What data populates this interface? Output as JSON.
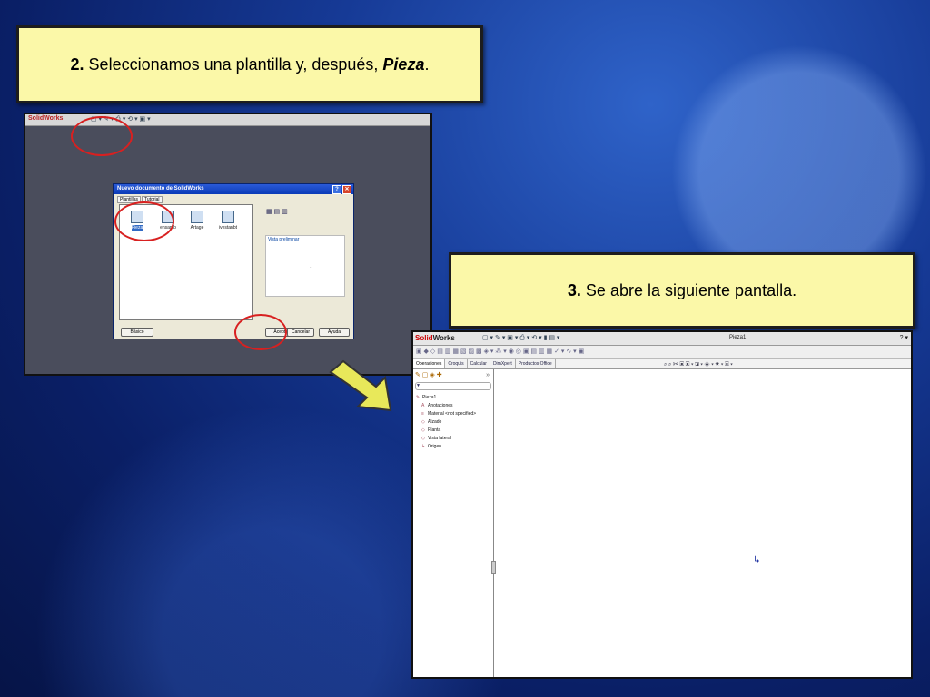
{
  "captions": {
    "step2": {
      "num": "2.",
      "text": " Seleccionamos una plantilla y, después, ",
      "emph": "Pieza",
      "end": "."
    },
    "step3": {
      "num": "3.",
      "text": " Se abre la siguiente pantalla."
    }
  },
  "shot1": {
    "app_logo": "SolidWorks",
    "dialog": {
      "title": "Nuevo documento de SolidWorks",
      "tabs": [
        "Plantillas",
        "Tutorial"
      ],
      "templates": [
        "Pieza",
        "ensamb",
        "Artage",
        "ivestanbt"
      ],
      "preview_label": "Vista preliminar",
      "buttons": {
        "basic": "Básico",
        "accept": "Aceptar",
        "cancel": "Cancelar",
        "help": "Ayuda"
      }
    }
  },
  "shot2": {
    "app_logo_a": "Solid",
    "app_logo_b": "Works",
    "doc_title": "Pieza1",
    "help": "? ▾",
    "tabs": [
      "Operaciones",
      "Croquis",
      "Calcular",
      "DimXpert",
      "Productos Office"
    ],
    "tree": [
      "Pieza1",
      "Anotaciones",
      "Material <not specified>",
      "Alzado",
      "Planta",
      "Vista lateral",
      "Origen"
    ]
  },
  "colors": {
    "caption_bg": "#fbf8a8",
    "highlight_ellipse": "#d82020",
    "arrow": "#e8e85a"
  }
}
